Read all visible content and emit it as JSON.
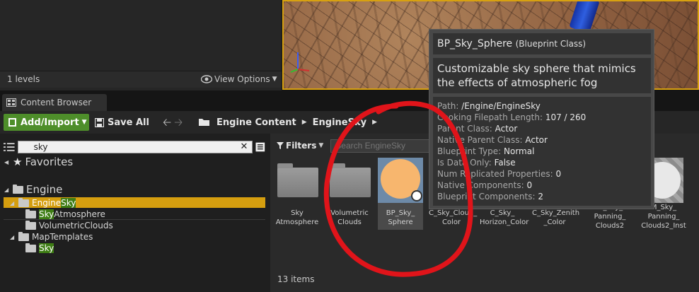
{
  "outliner": {
    "levels": "1 levels",
    "view_options": "View Options"
  },
  "content_browser": {
    "tab_label": "Content Browser",
    "toolbar": {
      "add_import": "Add/Import",
      "save_all": "Save All",
      "breadcrumbs": [
        "Engine Content",
        "EngineSky"
      ]
    },
    "sources": {
      "search_value": "sky",
      "favorites": "Favorites",
      "tree": {
        "engine": "Engine",
        "enginesky_a": "Engine",
        "enginesky_b": "Sky",
        "skyatmos_a": "Sky",
        "skyatmos_b": "Atmosphere",
        "volumetric": "VolumetricClouds",
        "maptemplates": "MapTemplates",
        "sky": "Sky"
      }
    },
    "assets": {
      "filters_label": "Filters",
      "search_placeholder": "Search EngineSky",
      "tiles": [
        {
          "line1": "Sky",
          "line2": "Atmosphere"
        },
        {
          "line1": "Volumetric",
          "line2": "Clouds"
        },
        {
          "line1": "BP_Sky_",
          "line2": "Sphere"
        },
        {
          "line1": "C_Sky_Cloud_",
          "line2": "Color"
        },
        {
          "line1": "C_Sky_",
          "line2": "Horizon_Color"
        },
        {
          "line1": "C_Sky_Zenith",
          "line2": "_Color"
        },
        {
          "line1": "M_Sky_",
          "line2": "Panning_",
          "line3": "Clouds2"
        },
        {
          "line1": "M_Sky_",
          "line2": "Panning_",
          "line3": "Clouds2_Inst"
        }
      ],
      "item_count": "13 items"
    }
  },
  "tooltip": {
    "name": "BP_Sky_Sphere",
    "type": "(Blueprint Class)",
    "description": "Customizable sky sphere that mimics the effects of atmospheric fog",
    "properties": [
      {
        "key": "Path:",
        "value": "/Engine/EngineSky"
      },
      {
        "key": "Cooking Filepath Length:",
        "value": "107 / 260"
      },
      {
        "key": "Parent Class:",
        "value": "Actor"
      },
      {
        "key": "Native Parent Class:",
        "value": "Actor"
      },
      {
        "key": "Blueprint Type:",
        "value": "Normal"
      },
      {
        "key": "Is Data Only:",
        "value": "False"
      },
      {
        "key": "Num Replicated Properties:",
        "value": "0"
      },
      {
        "key": "Native Components:",
        "value": "0"
      },
      {
        "key": "Blueprint Components:",
        "value": "2"
      }
    ]
  },
  "colors": {
    "accent_orange": "#d59e0f",
    "add_button_green": "#4e8e2a",
    "search_highlight_green": "#3e7d14",
    "annotation_red": "#e0141a"
  }
}
